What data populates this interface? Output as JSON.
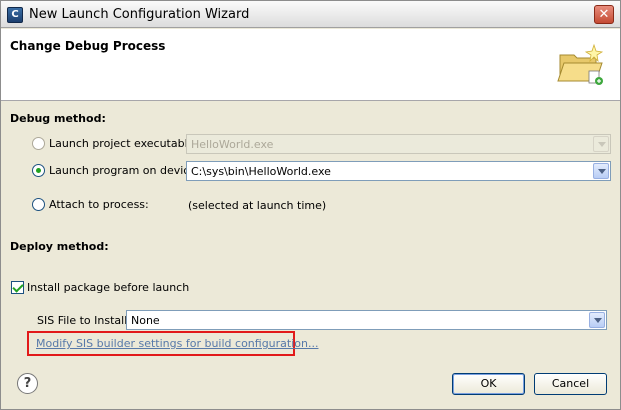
{
  "window": {
    "title": "New Launch Configuration Wizard",
    "app_icon_glyph": "C",
    "close_glyph": "✕"
  },
  "header": {
    "title": "Change Debug Process"
  },
  "debug_method": {
    "label": "Debug method:",
    "options": [
      {
        "label": "Launch project executable:",
        "selected": false,
        "enabled": false,
        "value": "HelloWorld.exe"
      },
      {
        "label": "Launch program on device:",
        "selected": true,
        "enabled": true,
        "value": "C:\\sys\\bin\\HelloWorld.exe"
      },
      {
        "label": "Attach to process:",
        "selected": false,
        "enabled": true,
        "value": "(selected at launch time)"
      }
    ]
  },
  "deploy_method": {
    "label": "Deploy method:",
    "install_checkbox_label": "Install package before launch",
    "install_checked": true,
    "sis_label": "SIS File to Install:",
    "sis_value": "None",
    "modify_link": "Modify SIS builder settings for build configuration..."
  },
  "footer": {
    "help_glyph": "?",
    "ok_label": "OK",
    "cancel_label": "Cancel"
  },
  "colors": {
    "highlight_border": "#e21a1a",
    "link": "#5779a9",
    "radio_dot": "#21a121"
  },
  "icons": [
    "app-icon",
    "close-icon",
    "folder-wizard-icon",
    "help-icon",
    "dropdown-arrow-icon"
  ]
}
